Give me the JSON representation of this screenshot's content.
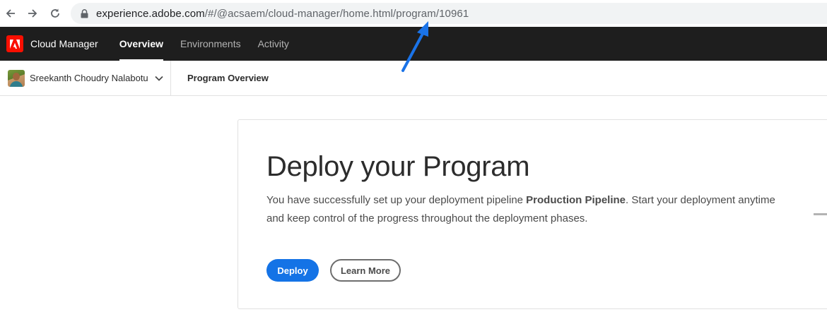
{
  "browser": {
    "url_host": "experience.adobe.com",
    "url_path": "/#/@acsaem/cloud-manager/home.html/program/10961",
    "icons": [
      "back-arrow-icon",
      "forward-arrow-icon",
      "reload-icon",
      "lock-icon"
    ]
  },
  "app": {
    "name": "Cloud Manager",
    "logo_icon": "adobe-logo-icon",
    "tabs": [
      {
        "label": "Overview",
        "active": true
      },
      {
        "label": "Environments",
        "active": false
      },
      {
        "label": "Activity",
        "active": false
      }
    ]
  },
  "subheader": {
    "user_name": "Sreekanth Choudry Nalabotu",
    "page_title": "Program Overview"
  },
  "card": {
    "heading": "Deploy your Program",
    "text_prefix": "You have successfully set up your deployment pipeline ",
    "text_bold": "Production Pipeline",
    "text_suffix": ". Start your deployment anytime and keep control of the progress throughout the deployment phases.",
    "deploy_label": "Deploy",
    "learn_more_label": "Learn More"
  },
  "colors": {
    "brand_red": "#fa0f00",
    "accent_blue": "#1473e6",
    "header_bg": "#1e1e1e",
    "annotation_arrow": "#1a73e8"
  }
}
